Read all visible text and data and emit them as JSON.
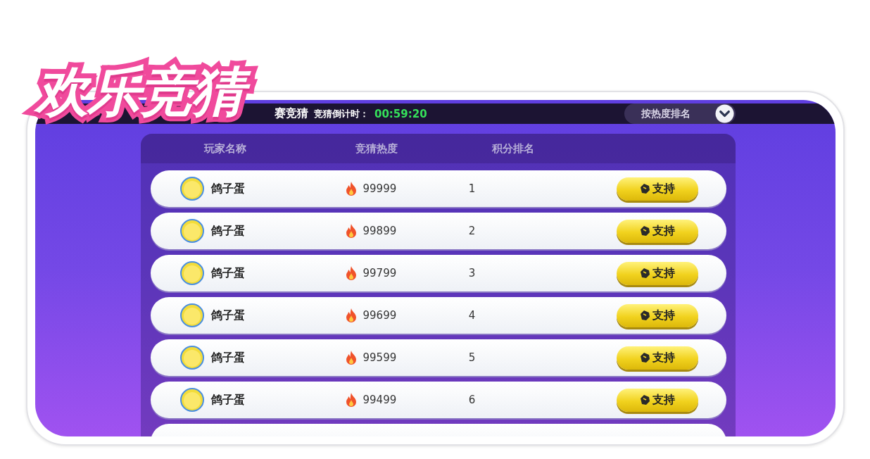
{
  "banner": {
    "title": "欢乐竞猜"
  },
  "top_bar": {
    "title": "赛竞猜",
    "countdown_label": "竞猜倒计时：",
    "countdown": "00:59:20",
    "sort": {
      "label": "按热度排名"
    }
  },
  "table": {
    "columns": [
      "玩家名称",
      "竞猜热度",
      "积分排名"
    ],
    "rows": [
      {
        "name": "鸽子蛋",
        "heat": "99999",
        "rank": "1",
        "button": "支持"
      },
      {
        "name": "鸽子蛋",
        "heat": "99899",
        "rank": "2",
        "button": "支持"
      },
      {
        "name": "鸽子蛋",
        "heat": "99799",
        "rank": "3",
        "button": "支持"
      },
      {
        "name": "鸽子蛋",
        "heat": "99699",
        "rank": "4",
        "button": "支持"
      },
      {
        "name": "鸽子蛋",
        "heat": "99599",
        "rank": "5",
        "button": "支持"
      },
      {
        "name": "鸽子蛋",
        "heat": "99499",
        "rank": "6",
        "button": "支持"
      }
    ]
  }
}
